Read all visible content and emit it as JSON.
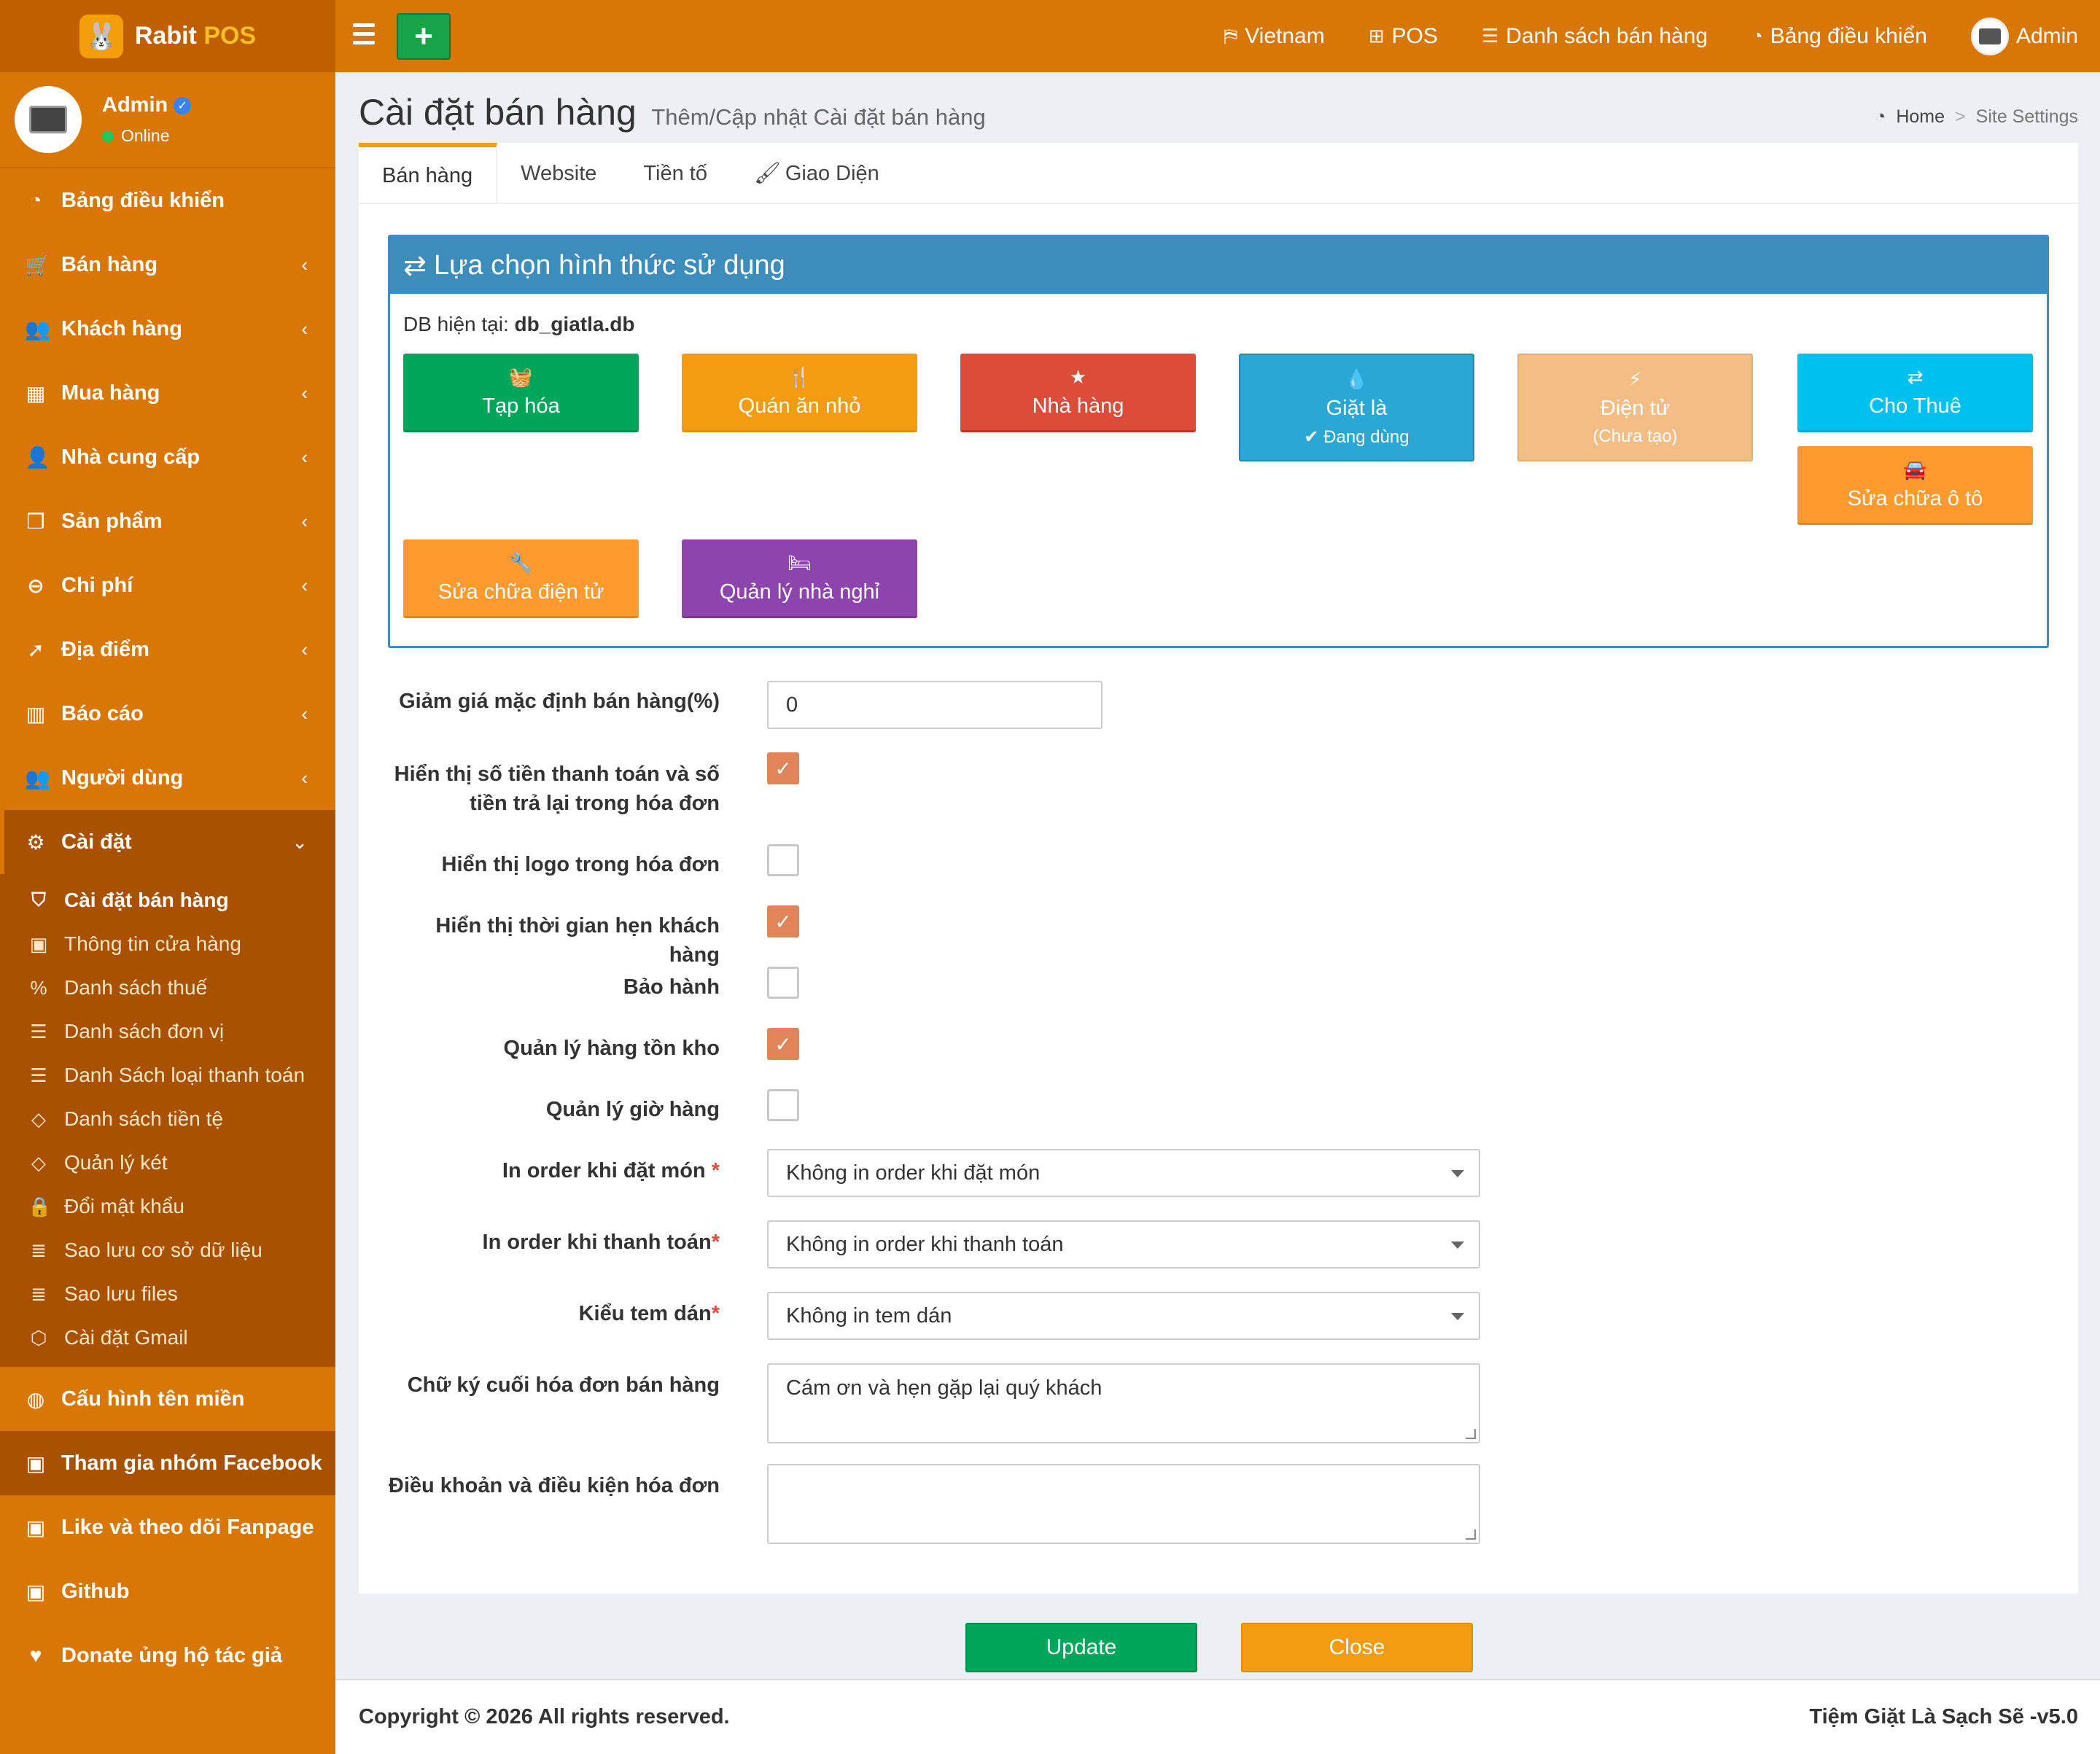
{
  "brand": {
    "name": "Rabit",
    "pos": "POS",
    "logo_icon": "rabbit-icon"
  },
  "topnav": {
    "language": "Vietnam",
    "pos": "POS",
    "sales_list": "Danh sách bán hàng",
    "dashboard": "Bảng điều khiển",
    "user": "Admin"
  },
  "user": {
    "name": "Admin",
    "status": "Online"
  },
  "sidebar": {
    "items": [
      {
        "label": "Bảng điều khiển",
        "icon": "dashboard-icon"
      },
      {
        "label": "Bán hàng",
        "icon": "cart-icon"
      },
      {
        "label": "Khách hàng",
        "icon": "users-icon"
      },
      {
        "label": "Mua hàng",
        "icon": "grid-icon"
      },
      {
        "label": "Nhà cung cấp",
        "icon": "user-plus-icon"
      },
      {
        "label": "Sản phẩm",
        "icon": "cubes-icon"
      },
      {
        "label": "Chi phí",
        "icon": "minus-circle-icon"
      },
      {
        "label": "Địa điểm",
        "icon": "send-icon"
      },
      {
        "label": "Báo cáo",
        "icon": "bar-chart-icon"
      },
      {
        "label": "Người dùng",
        "icon": "users-icon"
      },
      {
        "label": "Cài đặt",
        "icon": "gears-icon"
      }
    ],
    "settings_sub": [
      {
        "label": "Cài đặt bán hàng",
        "icon": "shield-icon"
      },
      {
        "label": "Thông tin cửa hàng",
        "icon": "briefcase-icon"
      },
      {
        "label": "Danh sách thuế",
        "icon": "percent-icon"
      },
      {
        "label": "Danh sách đơn vị",
        "icon": "list-icon"
      },
      {
        "label": "Danh Sách loại thanh toán",
        "icon": "list-icon"
      },
      {
        "label": "Danh sách tiền tệ",
        "icon": "code-icon"
      },
      {
        "label": "Quản lý két",
        "icon": "code-icon"
      },
      {
        "label": "Đổi mật khẩu",
        "icon": "lock-icon"
      },
      {
        "label": "Sao lưu cơ sở dữ liệu",
        "icon": "database-icon"
      },
      {
        "label": "Sao lưu files",
        "icon": "database-icon"
      },
      {
        "label": "Cài đặt Gmail",
        "icon": "cube-icon"
      }
    ],
    "extra": [
      {
        "label": "Cấu hình tên miền",
        "icon": "globe-icon"
      },
      {
        "label": "Tham gia nhóm Facebook",
        "icon": "briefcase-icon"
      },
      {
        "label": "Like và theo dõi Fanpage",
        "icon": "briefcase-icon"
      },
      {
        "label": "Github",
        "icon": "briefcase-icon"
      },
      {
        "label": "Donate ủng hộ tác giả",
        "icon": "heart-icon"
      }
    ]
  },
  "page": {
    "title": "Cài đặt bán hàng",
    "subtitle": "Thêm/Cập nhật Cài đặt bán hàng",
    "breadcrumb": {
      "home": "Home",
      "current": "Site Settings"
    }
  },
  "tabs": [
    "Bán hàng",
    "Website",
    "Tiền tố",
    "Giao Diện"
  ],
  "panel": {
    "title": "Lựa chọn hình thức sử dụng",
    "db_label": "DB hiện tại:",
    "db_value": "db_giatla.db",
    "modes": [
      {
        "label": "Tạp hóa",
        "color": "#00a65a",
        "icon": "basket-icon"
      },
      {
        "label": "Quán ăn nhỏ",
        "color": "#f39c12",
        "icon": "cutlery-icon"
      },
      {
        "label": "Nhà hàng",
        "color": "#dd4b39",
        "icon": "star-icon"
      },
      {
        "label": "Giặt là",
        "sub": "✔ Đang dùng",
        "color": "#2aa7d4",
        "icon": "drop-icon"
      },
      {
        "label": "Điện tử",
        "sub": "(Chưa tạo)",
        "color": "#f2be85",
        "icon": "bolt-icon"
      },
      {
        "label": "Cho Thuê",
        "color": "#00c0ef",
        "icon": "exchange-icon"
      },
      {
        "label": "Sửa chữa ô tô",
        "color": "#ff9a2e",
        "icon": "car-icon"
      },
      {
        "label": "Sửa chữa điện tử",
        "color": "#ff9a2e",
        "icon": "wrench-icon"
      },
      {
        "label": "Quản lý nhà nghỉ",
        "color": "#8e44ad",
        "icon": "bed-icon"
      }
    ]
  },
  "form": {
    "discount_label": "Giảm giá mặc định bán hàng(%)",
    "discount_value": "0",
    "show_paid_label_1": "Hiển thị số tiền thanh toán và số",
    "show_paid_label_2": "tiền trả lại trong hóa đơn",
    "show_paid": true,
    "show_logo_label": "Hiển thị logo trong hóa đơn",
    "show_logo": false,
    "show_time_label": "Hiển thị thời gian hẹn khách hàng",
    "show_time": true,
    "warranty_label": "Bảo hành",
    "warranty": false,
    "stock_label": "Quản lý hàng tồn kho",
    "stock": true,
    "hours_label": "Quản lý giờ hàng",
    "hours": false,
    "order_on_place_label": "In order khi đặt món ",
    "order_on_place_value": "Không in order khi đặt món",
    "order_on_pay_label": "In order khi thanh toán",
    "order_on_pay_value": "Không in order khi thanh toán",
    "sticker_label": "Kiểu tem dán",
    "sticker_value": "Không in tem dán",
    "signature_label": "Chữ ký cuối hóa đơn bán hàng",
    "signature_value": "Cám ơn và hẹn gặp lại quý khách",
    "terms_label": "Điều khoản và điều kiện hóa đơn",
    "terms_value": "",
    "required_mark": "*"
  },
  "actions": {
    "update": "Update",
    "close": "Close",
    "update_color": "#00a65a",
    "close_color": "#f39c12"
  },
  "footer": {
    "copyright": "Copyright © 2026 All rights reserved.",
    "shop": "Tiệm Giặt Là Sạch Sẽ -v5.0"
  }
}
